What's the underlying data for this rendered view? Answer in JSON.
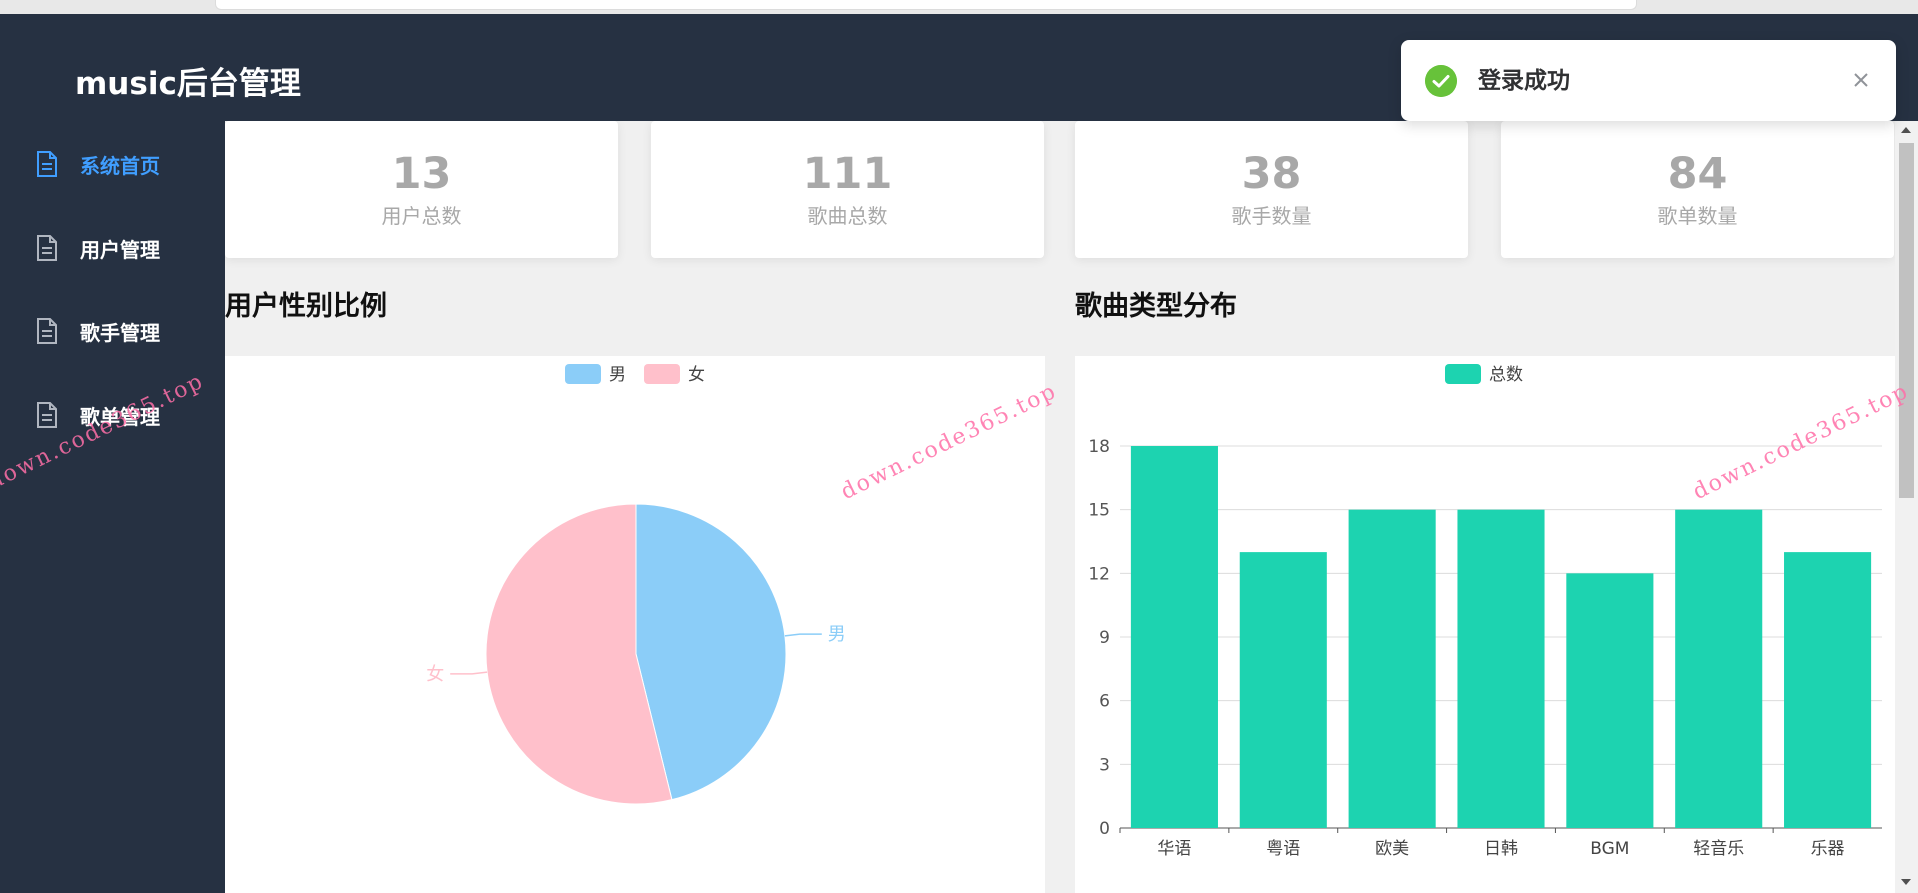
{
  "app": {
    "title": "music后台管理"
  },
  "sidebar": {
    "items": [
      {
        "label": "系统首页",
        "active": true
      },
      {
        "label": "用户管理",
        "active": false
      },
      {
        "label": "歌手管理",
        "active": false
      },
      {
        "label": "歌单管理",
        "active": false
      }
    ],
    "active_color": "#409eff"
  },
  "stats": [
    {
      "value": "13",
      "label": "用户总数"
    },
    {
      "value": "111",
      "label": "歌曲总数"
    },
    {
      "value": "38",
      "label": "歌手数量"
    },
    {
      "value": "84",
      "label": "歌单数量"
    }
  ],
  "sections": {
    "gender_title": "用户性别比例",
    "genre_title": "歌曲类型分布"
  },
  "toast": {
    "message": "登录成功",
    "icon": "check-circle-icon",
    "type": "success"
  },
  "watermark": "down.code365.top",
  "chart_data": [
    {
      "type": "pie",
      "labels": [
        "男",
        "女"
      ],
      "values": [
        6,
        7
      ],
      "colors": [
        "#8bcdf8",
        "#ffc0cb"
      ],
      "legend": [
        "男",
        "女"
      ],
      "legend_position": "top-center"
    },
    {
      "type": "bar",
      "categories": [
        "华语",
        "粤语",
        "欧美",
        "日韩",
        "BGM",
        "轻音乐",
        "乐器"
      ],
      "series": [
        {
          "name": "总数",
          "values": [
            18,
            13,
            15,
            15,
            12,
            15,
            13
          ]
        }
      ],
      "ylim": [
        0,
        18
      ],
      "yticks": [
        "0",
        "3",
        "6",
        "9",
        "12",
        "15",
        "18"
      ],
      "color": "#1dd3b0",
      "grid": true,
      "legend_position": "top-center"
    }
  ]
}
